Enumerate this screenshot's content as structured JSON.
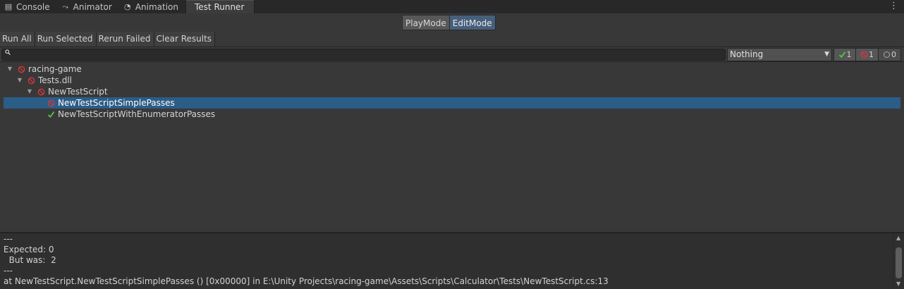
{
  "tabs": [
    {
      "label": "Console",
      "icon": "console-icon",
      "glyph": "▤"
    },
    {
      "label": "Animator",
      "icon": "animator-icon",
      "glyph": "⤳"
    },
    {
      "label": "Animation",
      "icon": "animation-icon",
      "glyph": "◔"
    },
    {
      "label": "Test Runner",
      "icon": "",
      "glyph": ""
    }
  ],
  "tab_menu_glyph": "⋮",
  "modes": {
    "playmode": "PlayMode",
    "editmode": "EditMode",
    "selected": "EditMode"
  },
  "actions": {
    "run_all": "Run All",
    "run_selected": "Run Selected",
    "rerun_failed": "Rerun Failed",
    "clear_results": "Clear Results"
  },
  "search": {
    "value": "",
    "placeholder": ""
  },
  "filter": {
    "selected": "Nothing"
  },
  "counters": {
    "passed": "1",
    "failed": "1",
    "skipped": "0"
  },
  "colors": {
    "pass": "#4fc943",
    "fail": "#d9363e",
    "selection": "#2c5d87",
    "mode_selected": "#46607c"
  },
  "tree": [
    {
      "label": "racing-game",
      "status": "fail",
      "expanded": true,
      "depth": 0
    },
    {
      "label": "Tests.dll",
      "status": "fail",
      "expanded": true,
      "depth": 1
    },
    {
      "label": "NewTestScript",
      "status": "fail",
      "expanded": true,
      "depth": 2
    },
    {
      "label": "NewTestScriptSimplePasses",
      "status": "fail",
      "expanded": false,
      "depth": 3,
      "selected": true
    },
    {
      "label": "NewTestScriptWithEnumeratorPasses",
      "status": "pass",
      "expanded": false,
      "depth": 3
    }
  ],
  "details": [
    "---",
    "Expected: 0",
    "  But was:  2",
    "---",
    "at NewTestScript.NewTestScriptSimplePasses () [0x00000] in E:\\Unity Projects\\racing-game\\Assets\\Scripts\\Calculator\\Tests\\NewTestScript.cs:13"
  ]
}
